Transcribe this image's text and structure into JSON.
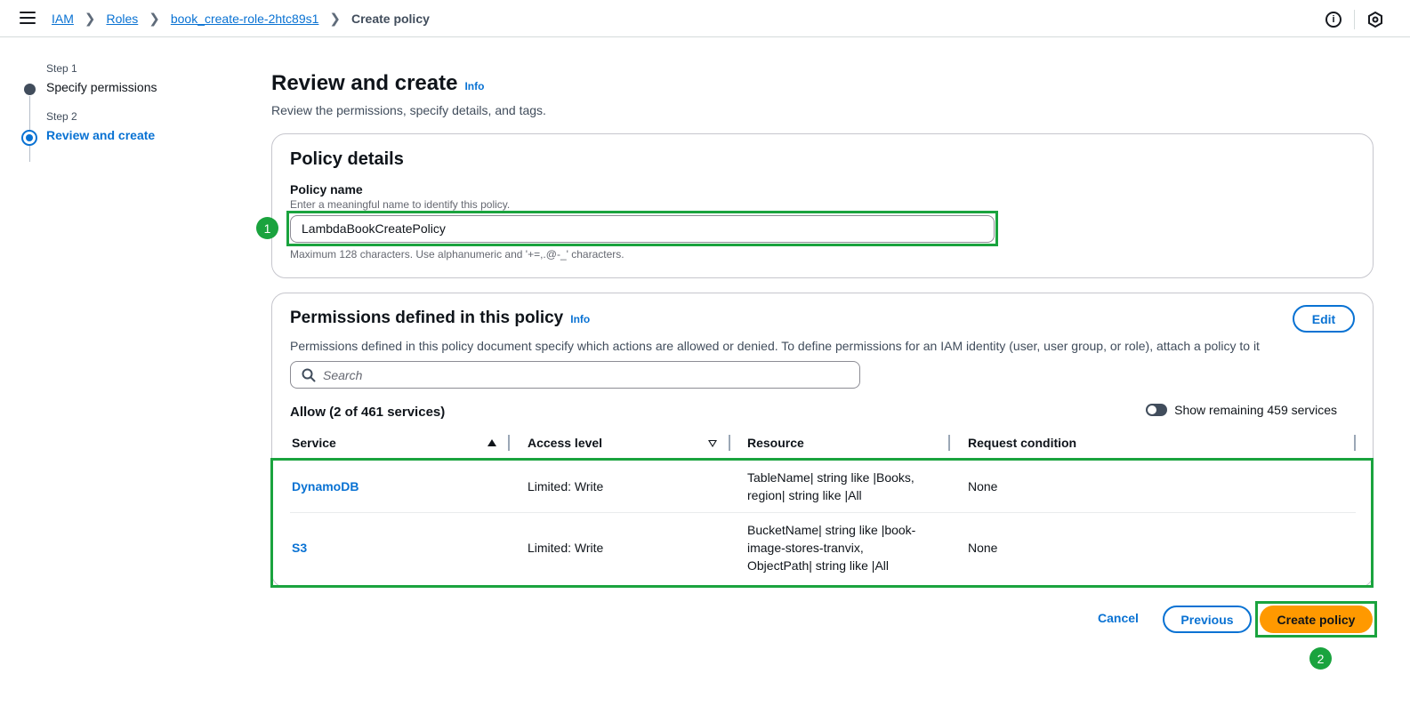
{
  "breadcrumbs": {
    "iam": "IAM",
    "roles": "Roles",
    "role": "book_create-role-2htc89s1",
    "current": "Create policy"
  },
  "top_icons": [
    "info-icon",
    "settings-hexagon-icon"
  ],
  "steps": [
    {
      "num": "Step 1",
      "title": "Specify permissions"
    },
    {
      "num": "Step 2",
      "title": "Review and create"
    }
  ],
  "header": {
    "title": "Review and create",
    "info": "Info",
    "description": "Review the permissions, specify details, and tags."
  },
  "policy_details": {
    "title": "Policy details",
    "name_label": "Policy name",
    "name_desc": "Enter a meaningful name to identify this policy.",
    "name_value": "LambdaBookCreatePolicy",
    "name_hint": "Maximum 128 characters. Use alphanumeric and '+=,.@-_' characters."
  },
  "permissions": {
    "title": "Permissions defined in this policy",
    "info": "Info",
    "edit": "Edit",
    "description": "Permissions defined in this policy document specify which actions are allowed or denied. To define permissions for an IAM identity (user, user group, or role), attach a policy to it",
    "search_placeholder": "Search",
    "allow_title": "Allow (2 of 461 services)",
    "toggle_label": "Show remaining 459 services",
    "columns": [
      "Service",
      "Access level",
      "Resource",
      "Request condition"
    ],
    "rows": [
      {
        "service": "DynamoDB",
        "access": "Limited: Write",
        "resource_lines": [
          "TableName| string like |Books,",
          "region| string like |All"
        ],
        "condition": "None"
      },
      {
        "service": "S3",
        "access": "Limited: Write",
        "resource_lines": [
          "BucketName| string like |book-",
          "image-stores-tranvix,",
          "ObjectPath| string like |All"
        ],
        "condition": "None"
      }
    ]
  },
  "buttons": {
    "cancel": "Cancel",
    "previous": "Previous",
    "create": "Create policy"
  },
  "badges": [
    "1",
    "2"
  ],
  "colors": {
    "accent": "#0972d3",
    "primary_button": "#ff9900",
    "highlight": "#1aa33e"
  }
}
